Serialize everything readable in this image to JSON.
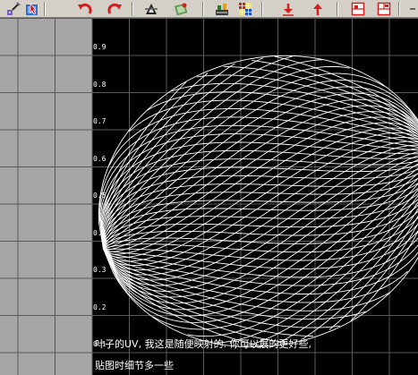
{
  "toolbar": {
    "icons": [
      "map-edit-icon",
      "select-uv-icon",
      "undo-icon",
      "redo-icon",
      "flip-icon",
      "rotate-map-icon",
      "uv-layout-icon",
      "checker-texture-icon",
      "move-down-icon",
      "move-up-icon",
      "view-split-icon",
      "view-options-icon"
    ]
  },
  "uv_editor": {
    "tick_labels": [
      "0.9",
      "0.8",
      "0.7",
      "0.6",
      "0.5",
      "0.4",
      "0.3",
      "0.2",
      "0.1"
    ],
    "caption_line1": "叶子的UV, 我这是随便映射的. 你可以展的更好些,",
    "caption_line2": "贴图时细节多一些"
  },
  "colors": {
    "toolbar_bg": "#d4d0c8",
    "grid_bg": "#a6a6a6",
    "uv_bg": "#000000",
    "mesh_line": "#ffffff",
    "grid_line": "#5a5a5a"
  }
}
